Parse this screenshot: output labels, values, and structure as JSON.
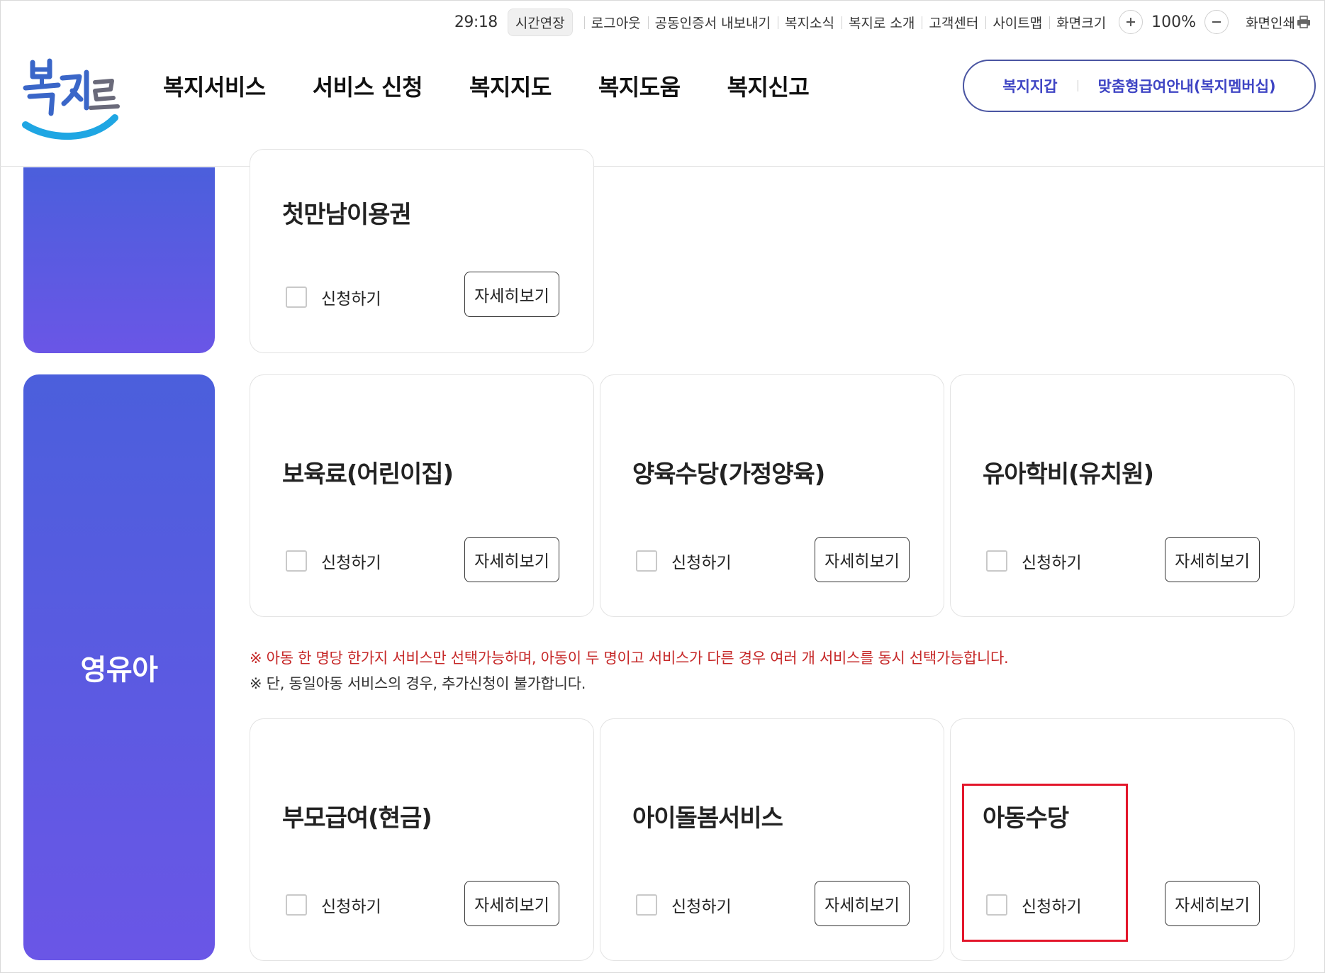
{
  "utility": {
    "timer": "29:18",
    "extend_label": "시간연장",
    "links": [
      "로그아웃",
      "공동인증서 내보내기",
      "복지소식",
      "복지로 소개",
      "고객센터",
      "사이트맵",
      "화면크기"
    ],
    "zoom_in_icon": "plus-icon",
    "zoom_value": "100%",
    "zoom_out_icon": "minus-icon",
    "print_label": "화면인쇄",
    "print_icon": "printer-icon"
  },
  "header": {
    "logo_text": "복지로",
    "nav": [
      "복지서비스",
      "서비스 신청",
      "복지지도",
      "복지도움",
      "복지신고"
    ],
    "quick_links": [
      "복지지갑",
      "맞춤형급여안내(복지멤버십)"
    ]
  },
  "category": {
    "label": "영유아"
  },
  "services_top": [
    {
      "title": "첫만남이용권",
      "apply_label": "신청하기",
      "detail_label": "자세히보기",
      "checked": false
    }
  ],
  "services_row1": [
    {
      "title": "보육료(어린이집)",
      "apply_label": "신청하기",
      "detail_label": "자세히보기",
      "checked": false
    },
    {
      "title": "양육수당(가정양육)",
      "apply_label": "신청하기",
      "detail_label": "자세히보기",
      "checked": false
    },
    {
      "title": "유아학비(유치원)",
      "apply_label": "신청하기",
      "detail_label": "자세히보기",
      "checked": false
    }
  ],
  "notice": {
    "line1": "※ 아동 한 명당 한가지 서비스만 선택가능하며, 아동이 두 명이고 서비스가 다른 경우 여러 개 서비스를 동시 선택가능합니다.",
    "line2": "※ 단, 동일아동 서비스의 경우, 추가신청이 불가합니다."
  },
  "services_row2": [
    {
      "title": "부모급여(현금)",
      "apply_label": "신청하기",
      "detail_label": "자세히보기",
      "checked": false
    },
    {
      "title": "아이돌봄서비스",
      "apply_label": "신청하기",
      "detail_label": "자세히보기",
      "checked": false
    },
    {
      "title": "아동수당",
      "apply_label": "신청하기",
      "detail_label": "자세히보기",
      "checked": false
    }
  ],
  "colors": {
    "accent": "#3e44c4",
    "category_gradient_top": "#4b5fdc",
    "category_gradient_bottom": "#6a56e6",
    "notice_red": "#c62828",
    "highlight": "#e3162b"
  }
}
